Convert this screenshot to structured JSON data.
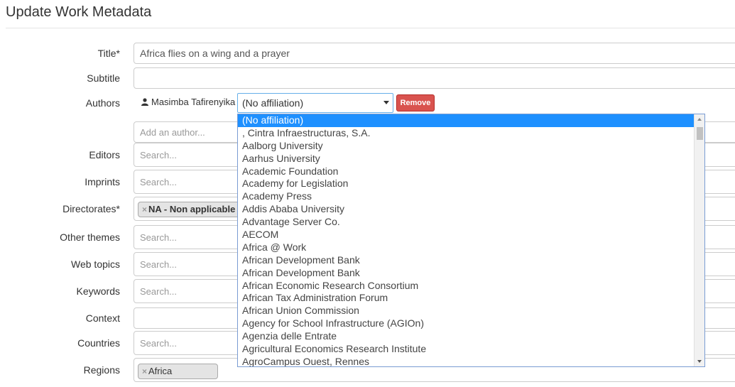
{
  "page": {
    "title": "Update Work Metadata"
  },
  "labels": {
    "title": "Title*",
    "subtitle": "Subtitle",
    "authors": "Authors",
    "editors": "Editors",
    "imprints": "Imprints",
    "directorates": "Directorates*",
    "other_themes": "Other themes",
    "web_topics": "Web topics",
    "keywords": "Keywords",
    "context": "Context",
    "countries": "Countries",
    "regions": "Regions"
  },
  "fields": {
    "title_value": "Africa flies on a wing and a prayer",
    "subtitle_value": "",
    "add_author_placeholder": "Add an author...",
    "search_placeholder": "Search...",
    "context_value": ""
  },
  "authors": [
    {
      "name": "Masimba Tafirenyika",
      "affiliation": "(No affiliation)",
      "remove_label": "Remove"
    }
  ],
  "directorates_chips": [
    {
      "x": "×",
      "label": "NA - Non applicable"
    }
  ],
  "regions_chips": [
    {
      "x": "×",
      "label": "Africa"
    }
  ],
  "affiliation_dropdown": {
    "selected": "(No affiliation)",
    "options": [
      "(No affiliation)",
      ", Cintra Infraestructuras, S.A.",
      "Aalborg University",
      "Aarhus University",
      "Academic Foundation",
      "Academy for Legislation",
      "Academy Press",
      "Addis Ababa University",
      "Advantage Server Co.",
      "AECOM",
      "Africa @ Work",
      "African Development Bank",
      "African Development Bank",
      "African Economic Research Consortium",
      "African Tax Administration Forum",
      "African Union Commission",
      "Agency for School Infrastructure (AGIOn)",
      "Agenzia delle Entrate",
      "Agricultural Economics Research Institute",
      "AgroCampus Ouest, Rennes"
    ]
  },
  "colors": {
    "remove_button": "#d9534f",
    "selected_option": "#1e90ff",
    "focus_border": "#66afe9"
  },
  "icons": {
    "author": "user-icon"
  }
}
